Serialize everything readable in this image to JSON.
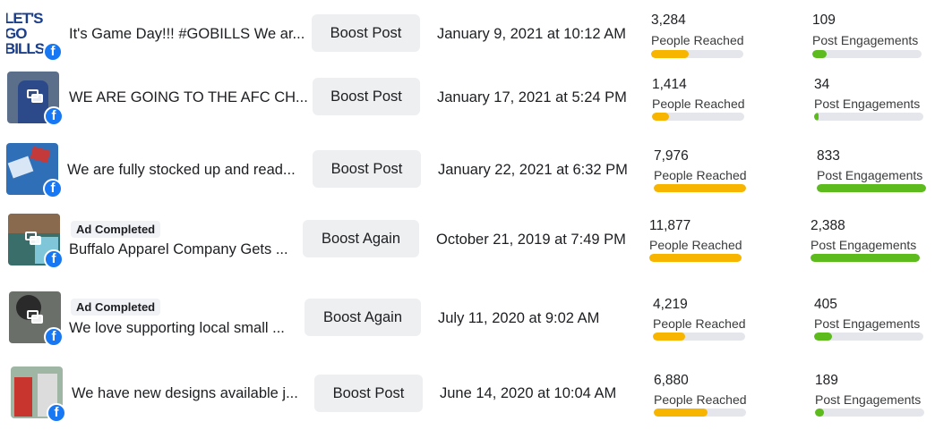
{
  "colors": {
    "reach_bar": "#f7b500",
    "engagement_bar": "#5dbb1d",
    "facebook": "#1877f2",
    "track": "#e4e6eb"
  },
  "icons": {
    "platform": "facebook-icon",
    "multi_photo": "multi-photo-icon"
  },
  "posts": [
    {
      "badge": "",
      "title": "It's Game Day!!! #GOBILLS We ar...",
      "thumb_text": "LET'S GO BILLS",
      "button": "Boost Post",
      "date": "January 9, 2021 at 10:12 AM",
      "reach_value": "3,284",
      "reach_label": "People Reached",
      "reach_fill": 0.41,
      "eng_value": "109",
      "eng_label": "Post Engagements",
      "eng_fill": 0.13
    },
    {
      "badge": "",
      "title": "WE ARE GOING TO THE AFC CH...",
      "button": "Boost Post",
      "date": "January 17, 2021 at 5:24 PM",
      "reach_value": "1,414",
      "reach_label": "People Reached",
      "reach_fill": 0.18,
      "eng_value": "34",
      "eng_label": "Post Engagements",
      "eng_fill": 0.04
    },
    {
      "badge": "",
      "title": "We are fully stocked up and read...",
      "button": "Boost Post",
      "date": "January 22, 2021 at 6:32 PM",
      "reach_value": "7,976",
      "reach_label": "People Reached",
      "reach_fill": 1.0,
      "eng_value": "833",
      "eng_label": "Post Engagements",
      "eng_fill": 1.0
    },
    {
      "badge": "Ad Completed",
      "title": "Buffalo Apparel Company Gets ...",
      "button": "Boost Again",
      "date": "October 21, 2019 at 7:49 PM",
      "reach_value": "11,877",
      "reach_label": "People Reached",
      "reach_fill": 1.0,
      "eng_value": "2,388",
      "eng_label": "Post Engagements",
      "eng_fill": 1.0
    },
    {
      "badge": "Ad Completed",
      "title": "We love supporting local small ...",
      "button": "Boost Again",
      "date": "July 11, 2020 at 9:02 AM",
      "reach_value": "4,219",
      "reach_label": "People Reached",
      "reach_fill": 0.35,
      "eng_value": "405",
      "eng_label": "Post Engagements",
      "eng_fill": 0.16
    },
    {
      "badge": "",
      "title": "We have new designs available j...",
      "button": "Boost Post",
      "date": "June 14, 2020 at 10:04 AM",
      "reach_value": "6,880",
      "reach_label": "People Reached",
      "reach_fill": 0.58,
      "eng_value": "189",
      "eng_label": "Post Engagements",
      "eng_fill": 0.08
    }
  ]
}
